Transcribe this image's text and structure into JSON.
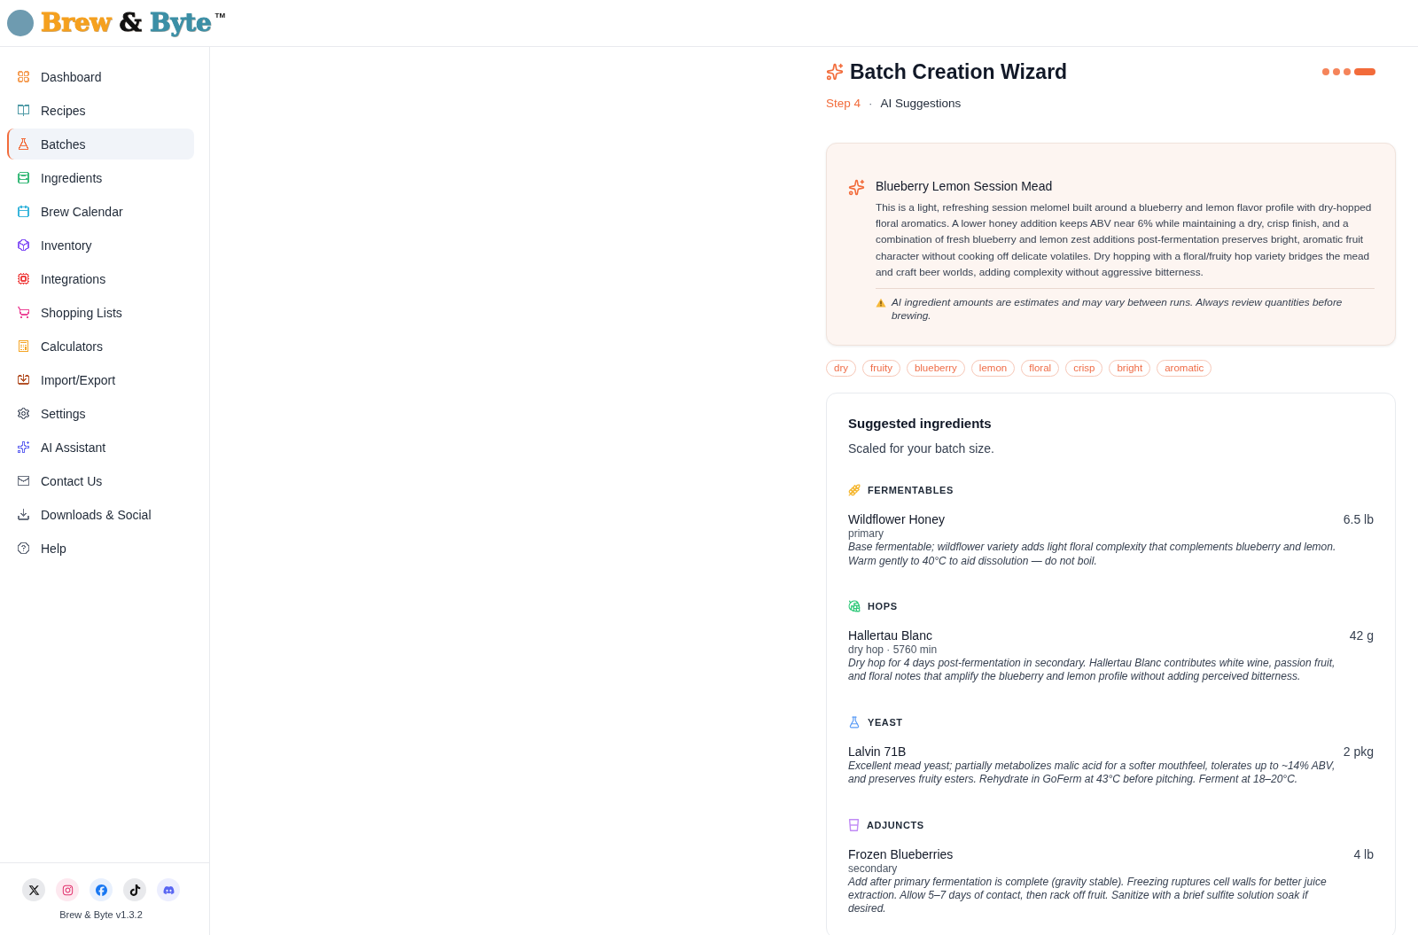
{
  "header": {
    "logo": {
      "words": [
        {
          "text": "Brew",
          "color": "#f5a01e"
        },
        {
          "text": "&",
          "color": "#111111"
        },
        {
          "text": "Byte",
          "color": "#3b8fa6"
        }
      ],
      "mark": "TM"
    }
  },
  "sidebar": {
    "items": [
      {
        "label": "Dashboard",
        "color": "#f5a15b",
        "selected": false
      },
      {
        "label": "Recipes",
        "color": "#4f9aa6",
        "selected": false
      },
      {
        "label": "Batches",
        "color": "#f26b3a",
        "selected": true
      },
      {
        "label": "Ingredients",
        "color": "#3dbb7c",
        "selected": false
      },
      {
        "label": "Brew Calendar",
        "color": "#3bb6dc",
        "selected": false
      },
      {
        "label": "Inventory",
        "color": "#8b5cf6",
        "selected": false
      },
      {
        "label": "Integrations",
        "color": "#ef4444",
        "selected": false
      },
      {
        "label": "Shopping Lists",
        "color": "#ec4899",
        "selected": false
      },
      {
        "label": "Calculators",
        "color": "#f5a524",
        "selected": false
      },
      {
        "label": "Import/Export",
        "color": "#b4532a",
        "selected": false
      },
      {
        "label": "Settings",
        "color": "#6b7280",
        "selected": false
      },
      {
        "label": "AI Assistant",
        "color": "#6366f1",
        "selected": false
      },
      {
        "label": "Contact Us",
        "color": "#6b7280",
        "selected": false
      },
      {
        "label": "Downloads & Social",
        "color": "#6b7280",
        "selected": false
      },
      {
        "label": "Help",
        "color": "#6b7280",
        "selected": false
      }
    ],
    "social_links": [
      {
        "kind": "x"
      },
      {
        "kind": "instagram"
      },
      {
        "kind": "facebook"
      },
      {
        "kind": "tiktok"
      },
      {
        "kind": "discord"
      }
    ],
    "version": "Brew & Byte v1.3.2"
  },
  "wizard": {
    "title": "Batch Creation Wizard",
    "steps": [
      {
        "selected": false
      },
      {
        "selected": false
      },
      {
        "selected": false
      },
      {
        "selected": true
      }
    ],
    "step_label": "Step 4",
    "separator": "·",
    "step_name": "AI Suggestions"
  },
  "suggestion": {
    "title": "Blueberry Lemon Session Mead",
    "description": "This is a light, refreshing session melomel built around a blueberry and lemon flavor profile with dry-hopped floral aromatics. A lower honey addition keeps ABV near 6% while maintaining a dry, crisp finish, and a combination of fresh blueberry and lemon zest additions post-fermentation preserves bright, aromatic fruit character without cooking off delicate volatiles. Dry hopping with a floral/fruity hop variety bridges the mead and craft beer worlds, adding complexity without aggressive bitterness.",
    "warning": "AI ingredient amounts are estimates and may vary between runs. Always review quantities before brewing."
  },
  "tags": [
    "dry",
    "fruity",
    "blueberry",
    "lemon",
    "floral",
    "crisp",
    "bright",
    "aromatic"
  ],
  "ingredients": {
    "title": "Suggested ingredients",
    "subtitle": "Scaled for your batch size.",
    "sections": [
      {
        "kind": "fermentables",
        "label": "FERMENTABLES",
        "items": [
          {
            "name": "Wildflower Honey",
            "amount": "6.5 lb",
            "detail": "primary",
            "note": "Base fermentable; wildflower variety adds light floral complexity that complements blueberry and lemon. Warm gently to 40°C to aid dissolution — do not boil."
          }
        ]
      },
      {
        "kind": "hops",
        "label": "HOPS",
        "items": [
          {
            "name": "Hallertau Blanc",
            "amount": "42 g",
            "detail": "dry hop · 5760 min",
            "note": "Dry hop for 4 days post-fermentation in secondary. Hallertau Blanc contributes white wine, passion fruit, and floral notes that amplify the blueberry and lemon profile without adding perceived bitterness."
          }
        ]
      },
      {
        "kind": "yeast",
        "label": "YEAST",
        "items": [
          {
            "name": "Lalvin 71B",
            "amount": "2 pkg",
            "note": "Excellent mead yeast; partially metabolizes malic acid for a softer mouthfeel, tolerates up to ~14% ABV, and preserves fruity esters. Rehydrate in GoFerm at 43°C before pitching. Ferment at 18–20°C."
          }
        ]
      },
      {
        "kind": "adjuncts",
        "label": "ADJUNCTS",
        "items": [
          {
            "name": "Frozen Blueberries",
            "amount": "4 lb",
            "detail": "secondary",
            "note": "Add after primary fermentation is complete (gravity stable). Freezing ruptures cell walls for better juice extraction. Allow 5–7 days of contact, then rack off fruit. Sanitize with a brief sulfite solution soak if desired."
          }
        ]
      }
    ]
  }
}
